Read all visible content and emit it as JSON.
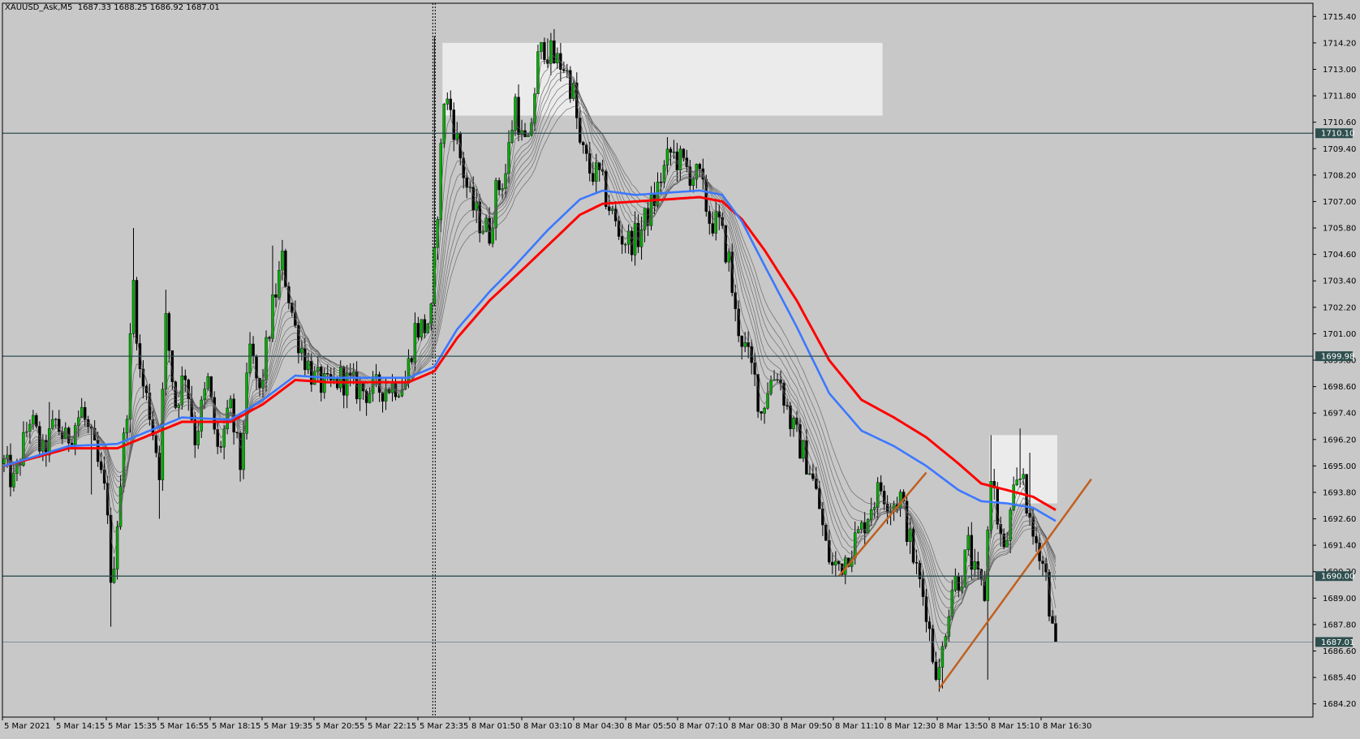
{
  "symbol_info": "XAUUSD_Ask,M5  1687.33 1688.25 1686.92 1687.01",
  "colors": {
    "background": "#c8c8c8",
    "bull": "#00b000",
    "bear": "#000000",
    "ma_red": "#ff0000",
    "ma_blue": "#3c78ff",
    "ma_grey": "#5a5a5a",
    "hline": "#2f4f4f",
    "zone": "#ebebeb",
    "trendline": "#c06020",
    "label_bg": "#2f4f4f",
    "label_text": "#ffffff"
  },
  "chart_data": {
    "type": "candlestick",
    "ylim": [
      1683.6,
      1716.0
    ],
    "y_ticks": [
      "1715.40",
      "1714.20",
      "1713.00",
      "1711.80",
      "1710.60",
      "1709.40",
      "1708.20",
      "1707.00",
      "1705.80",
      "1704.60",
      "1703.40",
      "1702.20",
      "1701.00",
      "1699.80",
      "1698.60",
      "1697.40",
      "1696.20",
      "1695.00",
      "1693.80",
      "1692.60",
      "1691.40",
      "1690.20",
      "1689.00",
      "1687.80",
      "1686.60",
      "1685.40",
      "1684.20"
    ],
    "x_ticks": [
      "5 Mar 2021",
      "5 Mar 14:15",
      "5 Mar 15:35",
      "5 Mar 16:55",
      "5 Mar 18:15",
      "5 Mar 19:35",
      "5 Mar 20:55",
      "5 Mar 22:15",
      "5 Mar 23:35",
      "8 Mar 01:50",
      "8 Mar 03:10",
      "8 Mar 04:30",
      "8 Mar 05:50",
      "8 Mar 07:10",
      "8 Mar 08:30",
      "8 Mar 09:50",
      "8 Mar 11:10",
      "8 Mar 12:30",
      "8 Mar 13:50",
      "8 Mar 15:10",
      "8 Mar 16:30"
    ],
    "bar_count": 405,
    "session_break_bar": 133,
    "horizontal_levels": [
      {
        "value": 1710.1,
        "label": "1710.10"
      },
      {
        "value": 1699.98,
        "label": "1699.98"
      },
      {
        "value": 1690.0,
        "label": "1690.00"
      }
    ],
    "current_price": {
      "value": 1687.01,
      "label": "1687.01"
    },
    "zones": [
      {
        "bar_from": 136,
        "bar_to": 272,
        "y_low": 1710.9,
        "y_high": 1714.2
      },
      {
        "bar_from": 305,
        "bar_to": 326,
        "y_low": 1693.3,
        "y_high": 1696.4
      }
    ],
    "trendlines": [
      {
        "bar1": 258,
        "y1": 1690.0,
        "bar2": 285,
        "y2": 1694.7
      },
      {
        "bar1": 289,
        "y1": 1684.9,
        "bar2": 336,
        "y2": 1694.4
      }
    ],
    "anchors": [
      [
        0,
        1695.1
      ],
      [
        3,
        1694.2
      ],
      [
        8,
        1697.2
      ],
      [
        12,
        1695.5
      ],
      [
        16,
        1697.0
      ],
      [
        19,
        1696.1
      ],
      [
        24,
        1697.5
      ],
      [
        28,
        1695.6
      ],
      [
        32,
        1693.2
      ],
      [
        33,
        1689.2
      ],
      [
        35,
        1692.6
      ],
      [
        38,
        1697.8
      ],
      [
        40,
        1703.3
      ],
      [
        42,
        1699.2
      ],
      [
        45,
        1697.5
      ],
      [
        48,
        1694.9
      ],
      [
        50,
        1701.5
      ],
      [
        53,
        1697.8
      ],
      [
        56,
        1699.3
      ],
      [
        59,
        1696.3
      ],
      [
        63,
        1698.8
      ],
      [
        66,
        1695.6
      ],
      [
        70,
        1697.5
      ],
      [
        73,
        1695.0
      ],
      [
        76,
        1700.3
      ],
      [
        79,
        1698.2
      ],
      [
        83,
        1702.2
      ],
      [
        86,
        1704.3
      ],
      [
        90,
        1701.2
      ],
      [
        93,
        1699.9
      ],
      [
        96,
        1698.9
      ],
      [
        100,
        1698.5
      ],
      [
        104,
        1699.0
      ],
      [
        108,
        1698.6
      ],
      [
        112,
        1698.4
      ],
      [
        116,
        1698.5
      ],
      [
        120,
        1698.7
      ],
      [
        124,
        1698.8
      ],
      [
        127,
        1701.2
      ],
      [
        130,
        1701.3
      ],
      [
        132,
        1701.8
      ],
      [
        134,
        1706.8
      ],
      [
        136,
        1711.7
      ],
      [
        138,
        1711.2
      ],
      [
        141,
        1709.0
      ],
      [
        144,
        1707.0
      ],
      [
        147,
        1706.1
      ],
      [
        150,
        1705.6
      ],
      [
        152,
        1707.4
      ],
      [
        155,
        1708.3
      ],
      [
        158,
        1711.6
      ],
      [
        160,
        1709.8
      ],
      [
        162,
        1709.4
      ],
      [
        165,
        1713.4
      ],
      [
        167,
        1714.1
      ],
      [
        170,
        1713.4
      ],
      [
        173,
        1713.2
      ],
      [
        176,
        1711.9
      ],
      [
        178,
        1709.5
      ],
      [
        181,
        1708.4
      ],
      [
        184,
        1708.1
      ],
      [
        187,
        1706.8
      ],
      [
        190,
        1705.5
      ],
      [
        193,
        1705.2
      ],
      [
        196,
        1705.4
      ],
      [
        198,
        1706.1
      ],
      [
        201,
        1707.1
      ],
      [
        203,
        1708.1
      ],
      [
        206,
        1709.2
      ],
      [
        209,
        1708.8
      ],
      [
        212,
        1708.3
      ],
      [
        215,
        1708.0
      ],
      [
        218,
        1706.2
      ],
      [
        221,
        1705.9
      ],
      [
        224,
        1704.3
      ],
      [
        226,
        1701.8
      ],
      [
        229,
        1700.3
      ],
      [
        232,
        1698.9
      ],
      [
        234,
        1697.4
      ],
      [
        236,
        1698.6
      ],
      [
        239,
        1699.3
      ],
      [
        241,
        1698.2
      ],
      [
        243,
        1697.0
      ],
      [
        246,
        1695.9
      ],
      [
        249,
        1694.9
      ],
      [
        252,
        1693.1
      ],
      [
        254,
        1691.3
      ],
      [
        256,
        1690.4
      ],
      [
        259,
        1690.6
      ],
      [
        262,
        1691.4
      ],
      [
        265,
        1692.1
      ],
      [
        268,
        1693.3
      ],
      [
        271,
        1694.0
      ],
      [
        274,
        1693.3
      ],
      [
        277,
        1693.6
      ],
      [
        279,
        1692.2
      ],
      [
        282,
        1690.2
      ],
      [
        285,
        1688.6
      ],
      [
        287,
        1686.4
      ],
      [
        289,
        1685.5
      ],
      [
        291,
        1687.8
      ],
      [
        293,
        1689.6
      ],
      [
        296,
        1690.1
      ],
      [
        298,
        1691.3
      ],
      [
        300,
        1690.0
      ],
      [
        303,
        1689.2
      ],
      [
        305,
        1694.8
      ],
      [
        307,
        1692.6
      ],
      [
        309,
        1690.9
      ],
      [
        312,
        1693.5
      ],
      [
        315,
        1694.8
      ],
      [
        317,
        1692.0
      ],
      [
        320,
        1691.3
      ],
      [
        322,
        1690.0
      ],
      [
        323,
        1688.8
      ],
      [
        324,
        1687.4
      ],
      [
        325,
        1687.01
      ]
    ],
    "spikes": [
      [
        14,
        "h",
        1697.9
      ],
      [
        27,
        "l",
        1693.7
      ],
      [
        33,
        "l",
        1687.7
      ],
      [
        40,
        "h",
        1705.8
      ],
      [
        48,
        "l",
        1692.6
      ],
      [
        50,
        "h",
        1703.0
      ],
      [
        83,
        "h",
        1705.0
      ],
      [
        133,
        "h",
        1714.5
      ],
      [
        168,
        "h",
        1714.4
      ],
      [
        207,
        "h",
        1709.8
      ],
      [
        290,
        "l",
        1684.9
      ],
      [
        304,
        "l",
        1685.3
      ],
      [
        305,
        "h",
        1696.4
      ],
      [
        314,
        "h",
        1696.7
      ],
      [
        317,
        "h",
        1695.6
      ]
    ],
    "ma": {
      "red": [
        [
          0,
          1695.0
        ],
        [
          20,
          1695.8
        ],
        [
          35,
          1695.8
        ],
        [
          45,
          1696.4
        ],
        [
          55,
          1697.0
        ],
        [
          70,
          1697.0
        ],
        [
          80,
          1697.8
        ],
        [
          90,
          1698.9
        ],
        [
          100,
          1698.8
        ],
        [
          125,
          1698.8
        ],
        [
          133,
          1699.3
        ],
        [
          140,
          1700.8
        ],
        [
          150,
          1702.5
        ],
        [
          158,
          1703.6
        ],
        [
          168,
          1705.0
        ],
        [
          178,
          1706.4
        ],
        [
          185,
          1706.9
        ],
        [
          195,
          1707.0
        ],
        [
          205,
          1707.1
        ],
        [
          215,
          1707.2
        ],
        [
          222,
          1707.0
        ],
        [
          228,
          1706.2
        ],
        [
          235,
          1704.8
        ],
        [
          245,
          1702.5
        ],
        [
          255,
          1699.8
        ],
        [
          265,
          1698.0
        ],
        [
          275,
          1697.2
        ],
        [
          285,
          1696.3
        ],
        [
          295,
          1695.1
        ],
        [
          302,
          1694.2
        ],
        [
          310,
          1693.9
        ],
        [
          318,
          1693.6
        ],
        [
          325,
          1693.0
        ]
      ],
      "blue": [
        [
          0,
          1695.0
        ],
        [
          20,
          1695.9
        ],
        [
          35,
          1696.0
        ],
        [
          45,
          1696.6
        ],
        [
          55,
          1697.2
        ],
        [
          70,
          1697.1
        ],
        [
          80,
          1698.0
        ],
        [
          90,
          1699.1
        ],
        [
          100,
          1699.0
        ],
        [
          125,
          1699.0
        ],
        [
          133,
          1699.5
        ],
        [
          140,
          1701.2
        ],
        [
          150,
          1702.9
        ],
        [
          158,
          1704.1
        ],
        [
          168,
          1705.7
        ],
        [
          178,
          1707.1
        ],
        [
          185,
          1707.5
        ],
        [
          195,
          1707.3
        ],
        [
          205,
          1707.4
        ],
        [
          215,
          1707.5
        ],
        [
          222,
          1707.3
        ],
        [
          228,
          1706.1
        ],
        [
          235,
          1704.1
        ],
        [
          245,
          1701.3
        ],
        [
          255,
          1698.3
        ],
        [
          265,
          1696.6
        ],
        [
          275,
          1695.9
        ],
        [
          285,
          1695.0
        ],
        [
          295,
          1693.9
        ],
        [
          302,
          1693.4
        ],
        [
          310,
          1693.3
        ],
        [
          318,
          1693.1
        ],
        [
          325,
          1692.5
        ]
      ]
    }
  }
}
